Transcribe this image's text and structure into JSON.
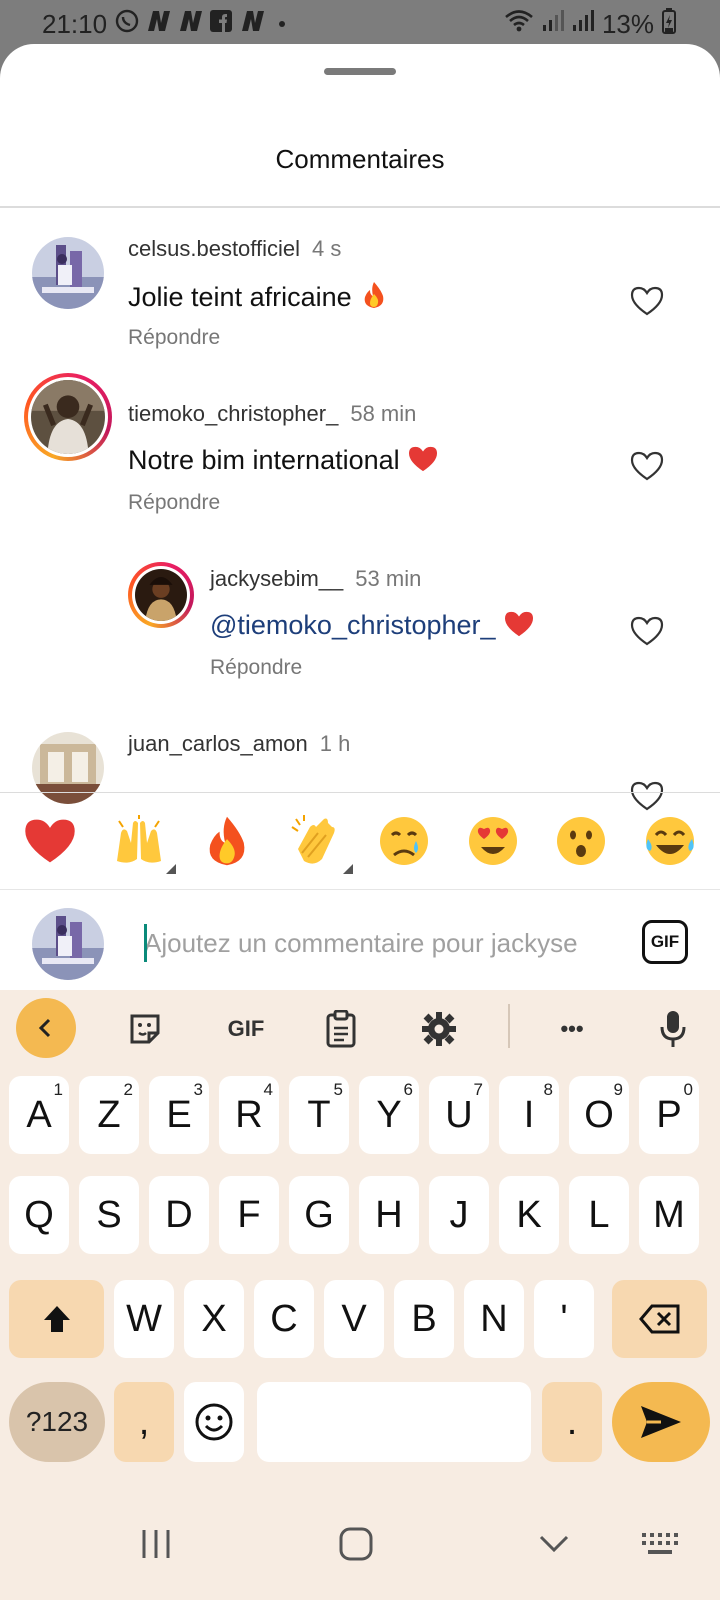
{
  "status_bar": {
    "time": "21:10",
    "notification_icons": [
      "whatsapp-icon",
      "n-app-icon",
      "n-app-icon",
      "facebook-icon",
      "n-app-icon"
    ],
    "battery": "13%"
  },
  "sheet": {
    "title": "Commentaires"
  },
  "comments": [
    {
      "username": "celsus.bestofficiel",
      "time": "4 s",
      "text": "Jolie teint africaine",
      "emoji": "fire",
      "reply_label": "Répondre"
    },
    {
      "username": "tiemoko_christopher_",
      "time": "58 min",
      "text": "Notre bim international",
      "emoji": "red-heart",
      "reply_label": "Répondre"
    },
    {
      "username": "jackysebim__",
      "time": "53 min",
      "mention": "@tiemoko_christopher_",
      "emoji": "red-heart",
      "reply_label": "Répondre"
    },
    {
      "username": "juan_carlos_amon",
      "time": "1 h"
    }
  ],
  "emoji_bar": [
    "red-heart",
    "raising-hands",
    "fire",
    "clapping-hands",
    "crying-face",
    "heart-eyes",
    "surprised-face",
    "tears-of-joy"
  ],
  "composer": {
    "placeholder": "Ajoutez un commentaire pour jackyse",
    "gif_label": "GIF"
  },
  "keyboard": {
    "toolbar": {
      "gif_label": "GIF",
      "more": "•••"
    },
    "row1": [
      {
        "key": "A",
        "sup": "1"
      },
      {
        "key": "Z",
        "sup": "2"
      },
      {
        "key": "E",
        "sup": "3"
      },
      {
        "key": "R",
        "sup": "4"
      },
      {
        "key": "T",
        "sup": "5"
      },
      {
        "key": "Y",
        "sup": "6"
      },
      {
        "key": "U",
        "sup": "7"
      },
      {
        "key": "I",
        "sup": "8"
      },
      {
        "key": "O",
        "sup": "9"
      },
      {
        "key": "P",
        "sup": "0"
      }
    ],
    "row2": [
      "Q",
      "S",
      "D",
      "F",
      "G",
      "H",
      "J",
      "K",
      "L",
      "M"
    ],
    "row3": [
      "W",
      "X",
      "C",
      "V",
      "B",
      "N",
      "'"
    ],
    "num_label": "?123",
    "comma": ",",
    "period": "."
  }
}
